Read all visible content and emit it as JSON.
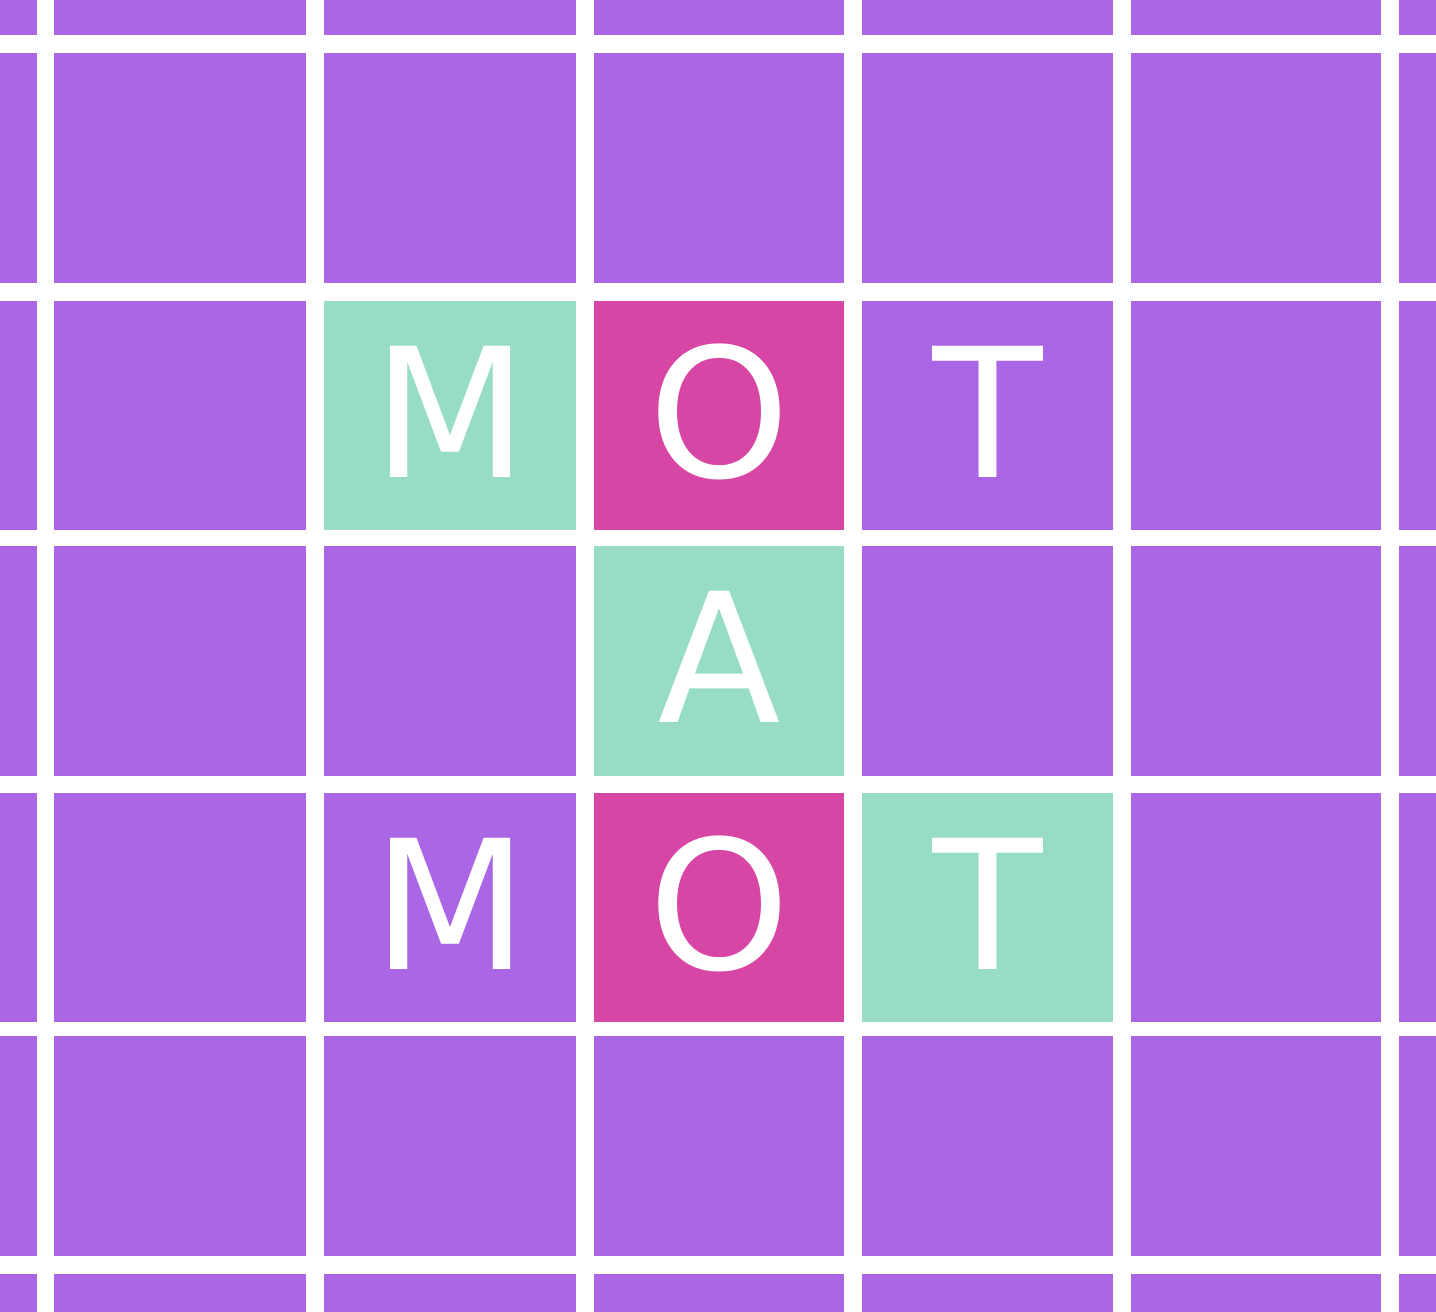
{
  "colors": {
    "background": "#ab66e6",
    "grid_line": "#ffffff",
    "highlight_teal": "#97dcc7",
    "highlight_pink": "#d746a5",
    "letter": "#ffffff"
  },
  "board": {
    "rows": [
      {
        "cells": [
          {
            "letter": "",
            "fill": "background"
          },
          {
            "letter": "",
            "fill": "background"
          },
          {
            "letter": "",
            "fill": "background"
          },
          {
            "letter": "",
            "fill": "background"
          },
          {
            "letter": "",
            "fill": "background"
          },
          {
            "letter": "",
            "fill": "background"
          },
          {
            "letter": "",
            "fill": "background"
          }
        ]
      },
      {
        "cells": [
          {
            "letter": "",
            "fill": "background"
          },
          {
            "letter": "",
            "fill": "background"
          },
          {
            "letter": "",
            "fill": "background"
          },
          {
            "letter": "",
            "fill": "background"
          },
          {
            "letter": "",
            "fill": "background"
          },
          {
            "letter": "",
            "fill": "background"
          },
          {
            "letter": "",
            "fill": "background"
          }
        ]
      },
      {
        "cells": [
          {
            "letter": "",
            "fill": "background"
          },
          {
            "letter": "",
            "fill": "background"
          },
          {
            "letter": "M",
            "fill": "highlight_teal"
          },
          {
            "letter": "O",
            "fill": "highlight_pink"
          },
          {
            "letter": "T",
            "fill": "background"
          },
          {
            "letter": "",
            "fill": "background"
          },
          {
            "letter": "",
            "fill": "background"
          }
        ]
      },
      {
        "cells": [
          {
            "letter": "",
            "fill": "background"
          },
          {
            "letter": "",
            "fill": "background"
          },
          {
            "letter": "",
            "fill": "background"
          },
          {
            "letter": "A",
            "fill": "highlight_teal"
          },
          {
            "letter": "",
            "fill": "background"
          },
          {
            "letter": "",
            "fill": "background"
          },
          {
            "letter": "",
            "fill": "background"
          }
        ]
      },
      {
        "cells": [
          {
            "letter": "",
            "fill": "background"
          },
          {
            "letter": "",
            "fill": "background"
          },
          {
            "letter": "M",
            "fill": "background"
          },
          {
            "letter": "O",
            "fill": "highlight_pink"
          },
          {
            "letter": "T",
            "fill": "highlight_teal"
          },
          {
            "letter": "",
            "fill": "background"
          },
          {
            "letter": "",
            "fill": "background"
          }
        ]
      },
      {
        "cells": [
          {
            "letter": "",
            "fill": "background"
          },
          {
            "letter": "",
            "fill": "background"
          },
          {
            "letter": "",
            "fill": "background"
          },
          {
            "letter": "",
            "fill": "background"
          },
          {
            "letter": "",
            "fill": "background"
          },
          {
            "letter": "",
            "fill": "background"
          },
          {
            "letter": "",
            "fill": "background"
          }
        ]
      },
      {
        "cells": [
          {
            "letter": "",
            "fill": "background"
          },
          {
            "letter": "",
            "fill": "background"
          },
          {
            "letter": "",
            "fill": "background"
          },
          {
            "letter": "",
            "fill": "background"
          },
          {
            "letter": "",
            "fill": "background"
          },
          {
            "letter": "",
            "fill": "background"
          },
          {
            "letter": "",
            "fill": "background"
          }
        ]
      }
    ]
  }
}
